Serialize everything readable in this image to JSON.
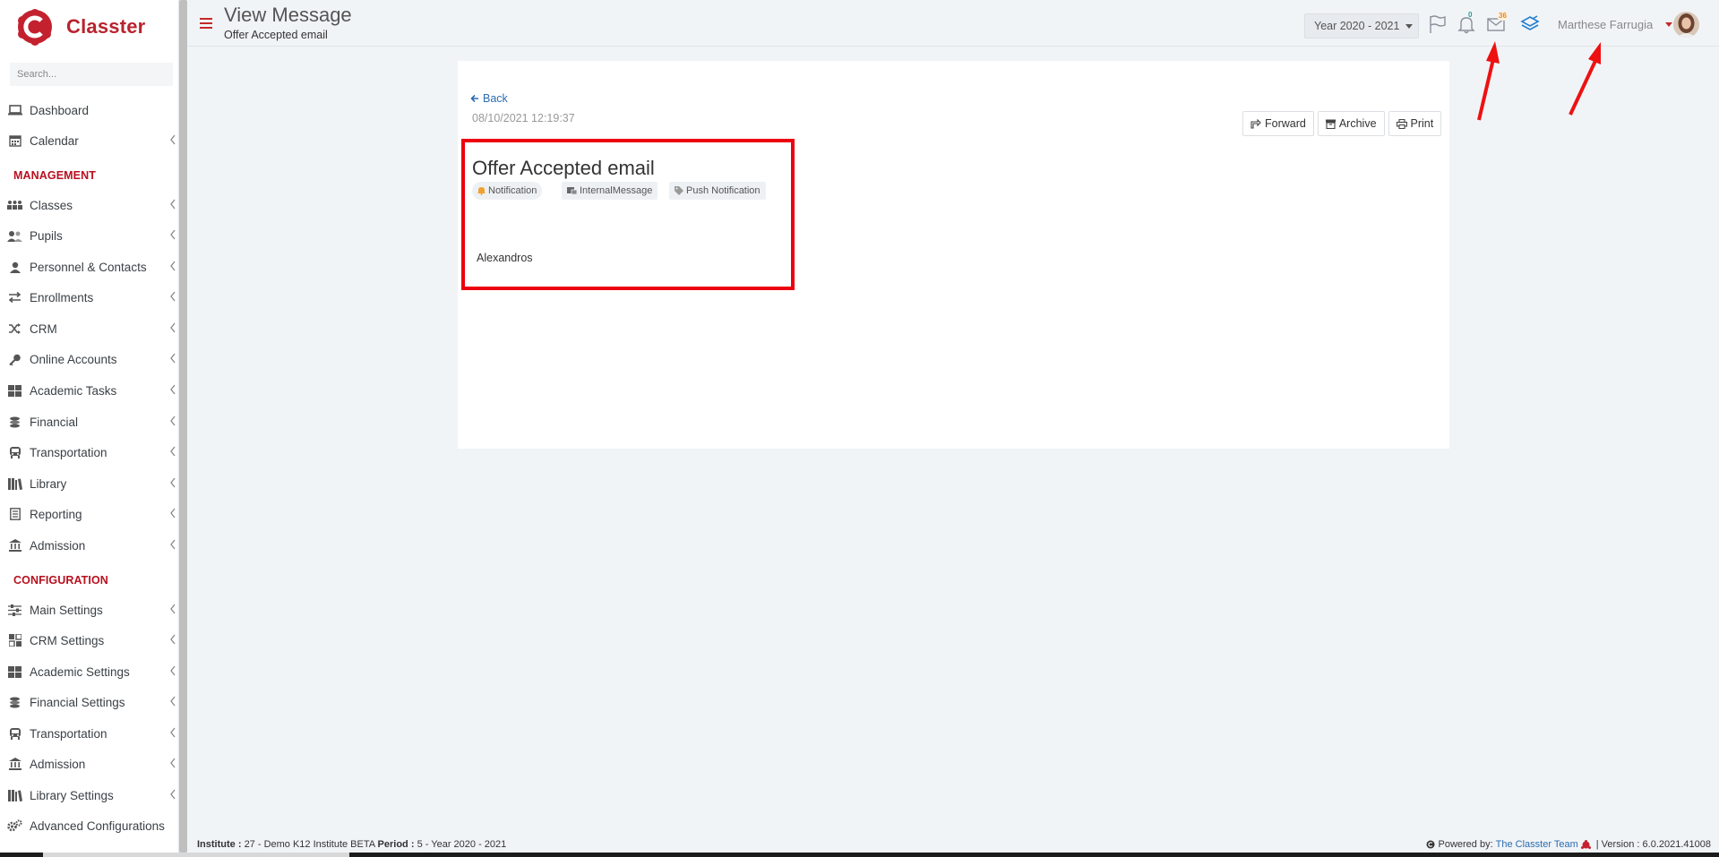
{
  "brand": {
    "name": "Classter"
  },
  "search": {
    "placeholder": "Search..."
  },
  "nav": {
    "items": [
      {
        "label": "Dashboard",
        "icon": "laptop-icon"
      },
      {
        "label": "Calendar",
        "icon": "calendar-icon"
      },
      {
        "label": "Classes",
        "icon": "classes-icon"
      },
      {
        "label": "Pupils",
        "icon": "users-icon"
      },
      {
        "label": "Personnel & Contacts",
        "icon": "person-icon"
      },
      {
        "label": "Enrollments",
        "icon": "exchange-icon"
      },
      {
        "label": "CRM",
        "icon": "random-icon"
      },
      {
        "label": "Online Accounts",
        "icon": "key-icon"
      },
      {
        "label": "Academic Tasks",
        "icon": "grid-icon"
      },
      {
        "label": "Financial",
        "icon": "coins-icon"
      },
      {
        "label": "Transportation",
        "icon": "bus-icon"
      },
      {
        "label": "Library",
        "icon": "books-icon"
      },
      {
        "label": "Reporting",
        "icon": "report-icon"
      },
      {
        "label": "Admission",
        "icon": "institution-icon"
      }
    ],
    "management_label": "MANAGEMENT",
    "configuration_label": "CONFIGURATION",
    "config_items": [
      {
        "label": "Main Settings",
        "icon": "sliders-icon"
      },
      {
        "label": "CRM Settings",
        "icon": "crm-settings-icon"
      },
      {
        "label": "Academic Settings",
        "icon": "grid-icon"
      },
      {
        "label": "Financial Settings",
        "icon": "coins-icon"
      },
      {
        "label": "Transportation",
        "icon": "bus-icon"
      },
      {
        "label": "Admission",
        "icon": "institution-icon"
      },
      {
        "label": "Library Settings",
        "icon": "books-icon"
      },
      {
        "label": "Advanced Configurations",
        "icon": "cogs-icon"
      }
    ]
  },
  "header": {
    "title": "View Message",
    "subtitle": "Offer Accepted email",
    "year": "Year 2020 - 2021",
    "notifications_count": "0",
    "messages_count": "36",
    "user_name": "Marthese Farrugia"
  },
  "message": {
    "back_label": "Back",
    "datetime": "08/10/2021 12:19:37",
    "title": "Offer Accepted email",
    "tags": [
      "Notification",
      "InternalMessage",
      "Push Notification"
    ],
    "body": "Alexandros",
    "actions": {
      "forward": "Forward",
      "archive": "Archive",
      "print": "Print"
    }
  },
  "footer": {
    "institute_label": "Institute :",
    "institute_value": "27 - Demo K12 Institute BETA",
    "period_label": "Period :",
    "period_value": "5 - Year 2020 - 2021",
    "powered_label": "Powered by:",
    "powered_link": "The Classter Team",
    "version": "| Version : 6.0.2021.41008"
  },
  "colors": {
    "brand": "#b8232f",
    "accent_link": "#2b6cb0",
    "highlight": "#ec0010"
  }
}
